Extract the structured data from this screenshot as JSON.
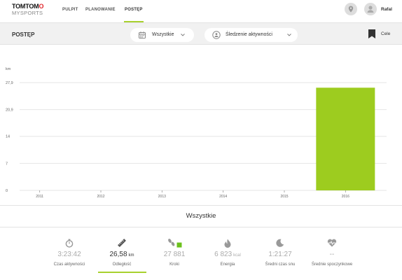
{
  "brand": {
    "line1_a": "TOMTOM",
    "line1_b": "O",
    "line2": "MYSPORTS"
  },
  "nav": {
    "items": [
      {
        "label": "PULPIT",
        "active": false
      },
      {
        "label": "PLANOWANIE",
        "active": false
      },
      {
        "label": "POSTĘP",
        "active": true
      }
    ]
  },
  "header": {
    "user_name": "Rafal",
    "location_icon": "location-pin-icon",
    "avatar_icon": "user-avatar-icon"
  },
  "subbar": {
    "title": "POSTĘP",
    "period_dropdown": {
      "icon": "calendar-icon",
      "value": "Wszystkie"
    },
    "activity_dropdown": {
      "icon": "activity-tracking-icon",
      "value": "Śledzenie aktywności"
    },
    "goals": {
      "icon": "bookmark-icon",
      "label": "Cele"
    }
  },
  "chart_data": {
    "type": "bar",
    "ylabel": "km",
    "yticks": [
      "0",
      "7",
      "14",
      "20,9",
      "27,9"
    ],
    "ylim": [
      0,
      27.9
    ],
    "categories": [
      "2011",
      "2012",
      "2013",
      "2014",
      "2015",
      "2016"
    ],
    "values": [
      0,
      0,
      0,
      0,
      0,
      26.58
    ],
    "grid": true,
    "bar_color": "#9dcc1f"
  },
  "summary": {
    "title": "Wszystkie",
    "stats": [
      {
        "icon": "stopwatch-icon",
        "value": "3:23:42",
        "unit": "",
        "label": "Czas aktywności",
        "active": false
      },
      {
        "icon": "ruler-icon",
        "value": "26,58",
        "unit": "km",
        "label": "Odległość",
        "active": true
      },
      {
        "icon": "steps-icon",
        "value": "27 881",
        "unit": "",
        "label": "Kroki",
        "active": false
      },
      {
        "icon": "flame-icon",
        "value": "6 823",
        "unit": "kcal",
        "label": "Energia",
        "active": false
      },
      {
        "icon": "moon-icon",
        "value": "1:21:27",
        "unit": "",
        "label": "Średni czas snu",
        "active": false
      },
      {
        "icon": "heart-rate-icon",
        "value": "--",
        "unit": "",
        "label": "Średnie spoczynkowe",
        "active": false
      }
    ]
  }
}
